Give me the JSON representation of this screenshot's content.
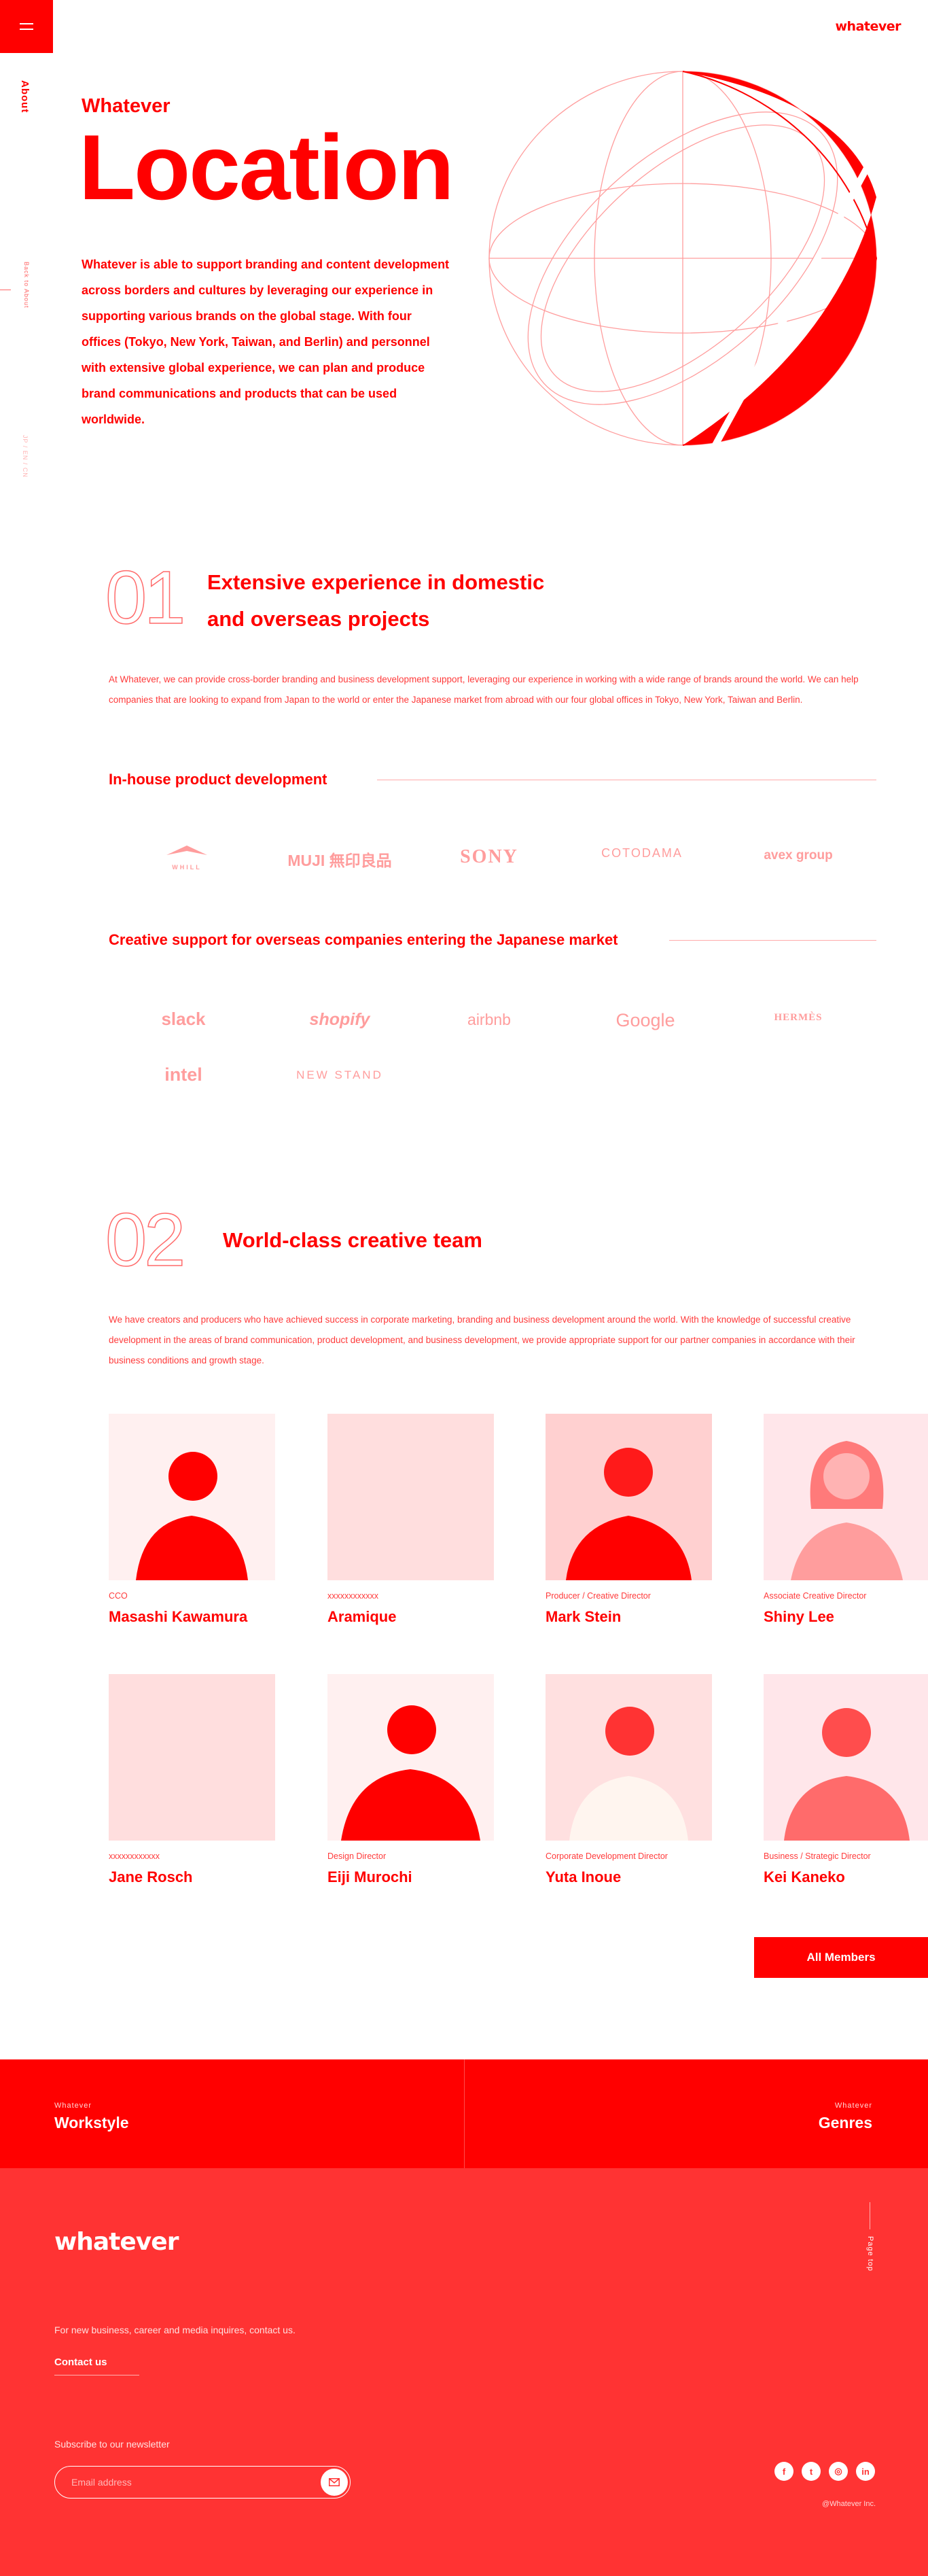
{
  "header": {
    "brand": "whatever",
    "menu_icon": "hamburger-icon"
  },
  "sidebar": {
    "about": "About",
    "back": "Back to About",
    "lang": "JP / EN / CN"
  },
  "hero": {
    "subtitle": "Whatever",
    "title": "Location",
    "text": "Whatever is able to support branding and content development across borders and cultures by leveraging our experience in supporting various brands on the global stage. With four offices (Tokyo, New York, Taiwan, and Berlin) and personnel with extensive global experience, we can plan and produce brand communications and products that can be used worldwide."
  },
  "section1": {
    "number": "01",
    "title_line1": "Extensive experience in domestic",
    "title_line2": "and overseas projects",
    "text": "At Whatever, we can provide cross-border branding and business development support, leveraging our experience in working with a wide range of brands around the world. We can help companies that are looking to expand from Japan to the world or enter the Japanese market from abroad with our four global offices in Tokyo, New York, Taiwan and Berlin.",
    "inhouse_heading": "In-house product development",
    "inhouse_logos": [
      "WHILL",
      "MUJI 無印良品",
      "SONY",
      "COTODAMA",
      "avex group"
    ],
    "support_heading": "Creative support for overseas companies entering the Japanese market",
    "support_logos": [
      "slack",
      "shopify",
      "airbnb",
      "Google",
      "HERMÈS",
      "intel",
      "NEW STAND"
    ]
  },
  "section2": {
    "number": "02",
    "title": "World-class creative team",
    "text": "We have creators and producers who have achieved success in corporate marketing, branding and business development around the world. With the knowledge of successful creative development in the areas of brand communication, product development, and business development, we provide appropriate support for our partner companies in accordance with their business conditions and growth stage.",
    "members": [
      {
        "role": "CCO",
        "name": "Masashi Kawamura"
      },
      {
        "role": "xxxxxxxxxxxx",
        "name": "Aramique"
      },
      {
        "role": "Producer / Creative Director",
        "name": "Mark Stein"
      },
      {
        "role": "Associate Creative Director",
        "name": "Shiny Lee"
      },
      {
        "role": "xxxxxxxxxxxx",
        "name": "Jane Rosch"
      },
      {
        "role": "Design Director",
        "name": "Eiji Murochi"
      },
      {
        "role": "Corporate Development Director",
        "name": "Yuta Inoue"
      },
      {
        "role": "Business / Strategic Director",
        "name": "Kei Kaneko"
      }
    ],
    "all_members": "All Members"
  },
  "nav": {
    "left_small": "Whatever",
    "left_big": "Workstyle",
    "right_small": "Whatever",
    "right_big": "Genres"
  },
  "footer": {
    "brand": "whatever",
    "inquiry": "For new business, career and media inquires, contact us.",
    "contact": "Contact us",
    "newsletter": "Subscribe to our newsletter",
    "email_placeholder": "Email address",
    "pagetop": "Page top",
    "socials": [
      "facebook-icon",
      "twitter-icon",
      "instagram-icon",
      "linkedin-icon"
    ],
    "copyright": "@Whatever Inc."
  },
  "colors": {
    "accent": "#ff0000",
    "footer": "#ff3333",
    "light": "#ffdede"
  }
}
